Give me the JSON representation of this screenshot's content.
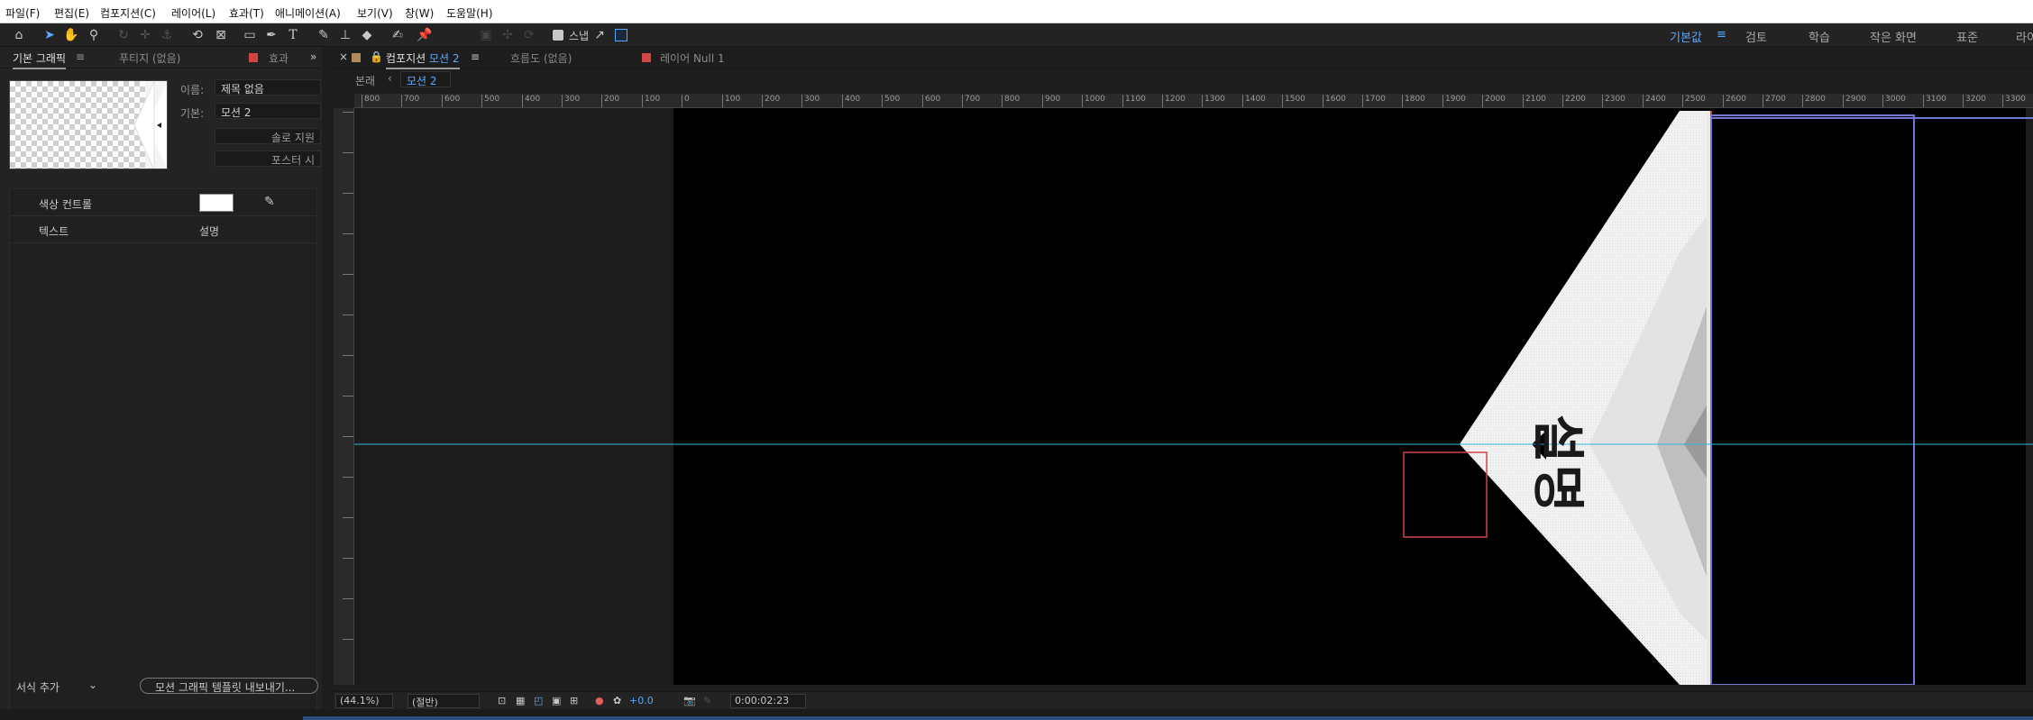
{
  "menu": [
    "파일(F)",
    "편집(E)",
    "컴포지션(C)",
    "레이어(L)",
    "효과(T)",
    "애니메이션(A)",
    "보기(V)",
    "창(W)",
    "도움말(H)"
  ],
  "toolbar": {
    "tools": [
      "home-icon",
      "selection-arrow-icon",
      "hand-icon",
      "zoom-icon",
      "rotate-icon",
      "camera-icon",
      "pan-behind-icon",
      "rectangle-icon",
      "pen-icon",
      "type-icon",
      "brush-icon",
      "clone-stamp-icon",
      "eraser-icon",
      "roto-brush-icon",
      "puppet-pin-icon"
    ],
    "snap_label": "스냅",
    "workspaces": [
      "기본값",
      "검토",
      "학습",
      "작은 화면",
      "표준",
      "라이"
    ]
  },
  "left_panel": {
    "tabs": [
      "기본 그래픽",
      "푸티지 (없음)",
      "효과"
    ],
    "name_label": "이름:",
    "name_value": "제목 없음",
    "base_label": "기본:",
    "base_value": "모션 2",
    "solo_button": "솔로 지원",
    "poster_button": "포스터 시",
    "properties": [
      {
        "name": "색상 컨트롤",
        "value": ""
      },
      {
        "name": "텍스트",
        "value": "설명"
      }
    ],
    "format_dropdown": "서식 추가",
    "export_button": "모션 그래픽 템플릿 내보내기..."
  },
  "comp_panel": {
    "tabs": [
      {
        "prefix": "컴포지션",
        "name": "모션 2"
      },
      {
        "prefix": "흐름도",
        "name": "(없음)"
      },
      {
        "prefix": "레이어",
        "name": "Null 1"
      }
    ],
    "breadcrumb_label": "본래",
    "breadcrumb_item": "모션 2",
    "ruler_ticks": [
      "800",
      "700",
      "600",
      "500",
      "400",
      "300",
      "200",
      "100",
      "0",
      "100",
      "200",
      "300",
      "400",
      "500",
      "600",
      "700",
      "800",
      "900",
      "1000",
      "1100",
      "1200",
      "1300",
      "1400",
      "1500",
      "1600",
      "1700",
      "1800",
      "1900",
      "2000",
      "2100",
      "2200",
      "2300",
      "2400",
      "2500",
      "2600",
      "2700",
      "2800",
      "2900",
      "3000",
      "3100",
      "3200",
      "3300"
    ],
    "canvas_text": "설명",
    "status": {
      "zoom": "(44.1%)",
      "resolution": "(절반)",
      "exposure": "+0.0",
      "timecode": "0:00:02:23"
    }
  },
  "colors": {
    "accent_blue": "#5aa7ff",
    "guide_cyan": "#35b6d8",
    "layer_red": "#d14545",
    "bbox_blue": "#6f78d8",
    "comp_black": "#000000"
  }
}
